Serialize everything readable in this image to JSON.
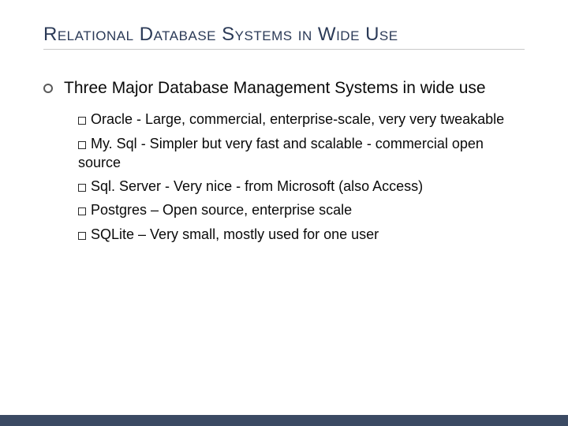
{
  "title": "Relational Database Systems in Wide Use",
  "level1": {
    "text": "Three Major Database Management Systems in wide use"
  },
  "items": [
    {
      "name": "Oracle",
      "desc": " - Large, commercial, enterprise-scale, very very tweakable"
    },
    {
      "name": "My. Sql",
      "desc": " - Simpler but very fast and scalable - commercial open source"
    },
    {
      "name": "Sql. Server",
      "desc": " - Very nice - from Microsoft (also Access)"
    },
    {
      "name": "Postgres",
      "desc": " – Open source, enterprise scale"
    },
    {
      "name": "SQLite",
      "desc": " – Very small, mostly used for one user"
    }
  ]
}
